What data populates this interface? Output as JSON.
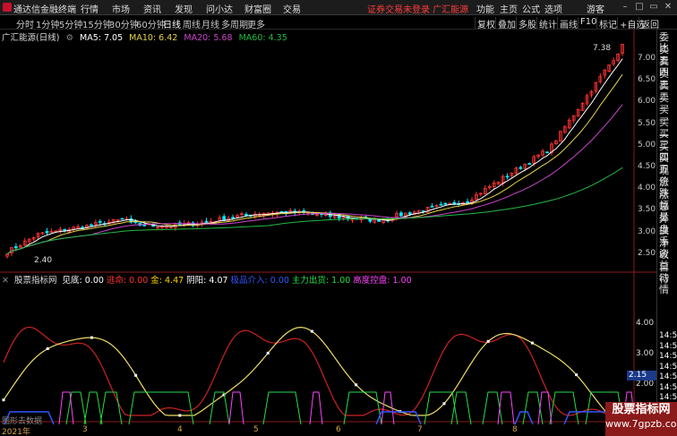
{
  "menubar": {
    "app_title": "通达信金融终端",
    "menus": [
      "行情",
      "市场",
      "资讯",
      "发现",
      "问小达",
      "财富圈",
      "交易"
    ],
    "notice": "证券交易未登录",
    "notice2": "广汇能源",
    "right_menus": [
      "功能",
      "主页",
      "公式",
      "选项",
      "游客"
    ]
  },
  "periods": [
    "分时",
    "1分钟",
    "5分钟",
    "15分钟",
    "30分钟",
    "60分钟",
    "日线",
    "周线",
    "月线",
    "多周期",
    "更多"
  ],
  "active_period": "日线",
  "tools": [
    "复权",
    "叠加",
    "多股",
    "统计",
    "画线",
    "F10",
    "标记",
    "+自选",
    "返回"
  ],
  "main_info": {
    "title": "广汇能源(日线)",
    "ma5": "MA5: 7.05",
    "ma10": "MA10: 6.42",
    "ma20": "MA20: 5.68",
    "ma60": "MA60: 4.35"
  },
  "colors": {
    "up": "#ff3333",
    "down": "#00e6ff",
    "ma5": "#ffffff",
    "ma10": "#e6d44a",
    "ma20": "#cc44cc",
    "ma60": "#22bb44"
  },
  "price_axis": [
    "7.00",
    "6.50",
    "6.00",
    "5.50",
    "5.00",
    "4.50",
    "4.00",
    "3.50",
    "3.00",
    "2.50"
  ],
  "high_label": "7.38",
  "low_label": "2.40",
  "indicator": {
    "title": "股票指标网",
    "items": [
      {
        "text": "见底: 0.00",
        "color": "#ffffff"
      },
      {
        "text": "逃命: 0.00",
        "color": "#ff3333"
      },
      {
        "text": "金: 4.47",
        "color": "#ffd700"
      },
      {
        "text": "阴阳: 4.07",
        "color": "#ffffff"
      },
      {
        "text": "极品介入: 0.00",
        "color": "#3355ff"
      },
      {
        "text": "主力出货: 1.00",
        "color": "#22dd44"
      },
      {
        "text": "高度控盘: 1.00",
        "color": "#ff44ff"
      }
    ],
    "axis": [
      "4.00",
      "3.00",
      "2.00",
      "1.00"
    ],
    "current": "2.15"
  },
  "sidebar": [
    "委比",
    "卖五",
    "卖四",
    "卖三",
    "卖二",
    "卖一",
    "买一",
    "买二",
    "买三",
    "买四",
    "买五",
    "现价",
    "涨跌",
    "涨幅",
    "总量",
    "外盘",
    "换手",
    "净资",
    "收益",
    "自动",
    "行情"
  ],
  "sidebar_times": [
    "14:56",
    "14:56",
    "14:56",
    "14:56",
    "14:56",
    "14:56",
    "14:56",
    "14:56",
    "14:56",
    "14:56"
  ],
  "x_labels": [
    "2021年",
    "3",
    "4",
    "5",
    "6",
    "7",
    "8"
  ],
  "data_button": "图形去数据",
  "watermark": {
    "title": "股票指标网",
    "url": "www.7gpzb.com"
  }
}
